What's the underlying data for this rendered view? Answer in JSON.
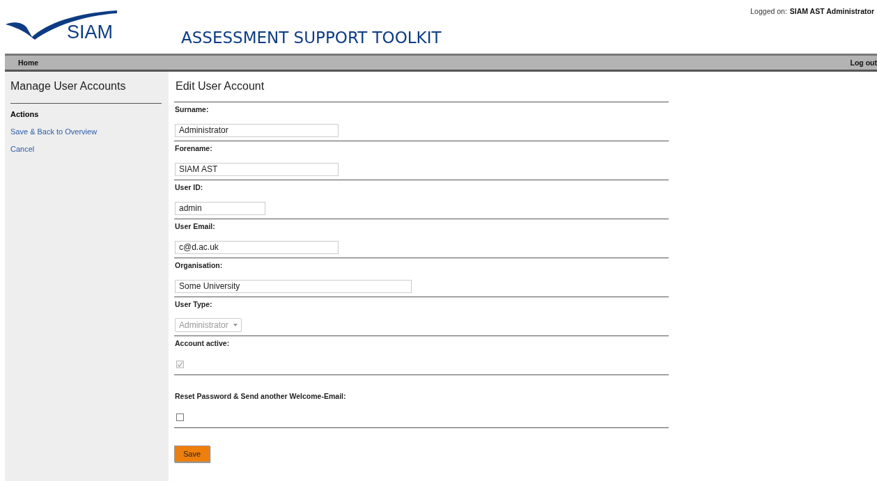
{
  "header": {
    "logo_text": "SIAM",
    "title": "ASSESSMENT SUPPORT TOOLKIT",
    "logged_on_label": "Logged on:",
    "logged_on_user": "SIAM AST Administrator"
  },
  "nav": {
    "home": "Home",
    "logout": "Log out"
  },
  "sidebar": {
    "title": "Manage User Accounts",
    "section": "Actions",
    "links": [
      "Save & Back to Overview",
      "Cancel"
    ]
  },
  "form": {
    "title": "Edit User Account",
    "fields": [
      {
        "kind": "text",
        "label": "Surname:",
        "value": "Administrator"
      },
      {
        "kind": "text",
        "label": "Forename:",
        "value": "SIAM AST"
      },
      {
        "kind": "text",
        "label": "User ID:",
        "value": "admin"
      },
      {
        "kind": "text",
        "label": "User Email:",
        "value": "c@d.ac.uk"
      },
      {
        "kind": "text",
        "label": "Organisation:",
        "value": "Some University"
      },
      {
        "kind": "select",
        "label": "User Type:",
        "value": "Administrator",
        "disabled": true
      },
      {
        "kind": "checkbox",
        "label": "Account active:",
        "checked": true,
        "disabled": true
      },
      {
        "kind": "checkbox",
        "label": "Reset Password & Send another Welcome-Email:",
        "checked": false,
        "disabled": false,
        "spaced": true
      }
    ],
    "save": "Save"
  }
}
